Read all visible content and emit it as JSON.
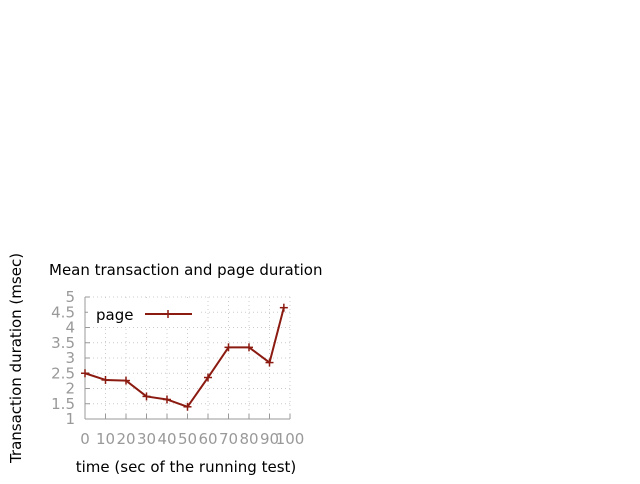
{
  "chart_data": {
    "type": "line",
    "title": "Mean transaction and page duration",
    "xlabel": "time (sec of the running test)",
    "ylabel": "Transaction duration (msec)",
    "xlim": [
      0,
      100
    ],
    "ylim": [
      1,
      5
    ],
    "x_ticks": [
      "0",
      "10",
      "20",
      "30",
      "40",
      "50",
      "60",
      "70",
      "80",
      "90",
      "100"
    ],
    "y_ticks": [
      "1",
      "1.5",
      "2",
      "2.5",
      "3",
      "3.5",
      "4",
      "4.5",
      "5"
    ],
    "grid": true,
    "legend_position": "top-left",
    "series": [
      {
        "name": "page",
        "color": "#8b1a10",
        "x": [
          0,
          10,
          20,
          30,
          40,
          50,
          60,
          70,
          80,
          90,
          97
        ],
        "y": [
          2.5,
          2.28,
          2.26,
          1.74,
          1.64,
          1.4,
          2.36,
          3.35,
          3.35,
          2.85,
          4.65
        ]
      }
    ]
  }
}
